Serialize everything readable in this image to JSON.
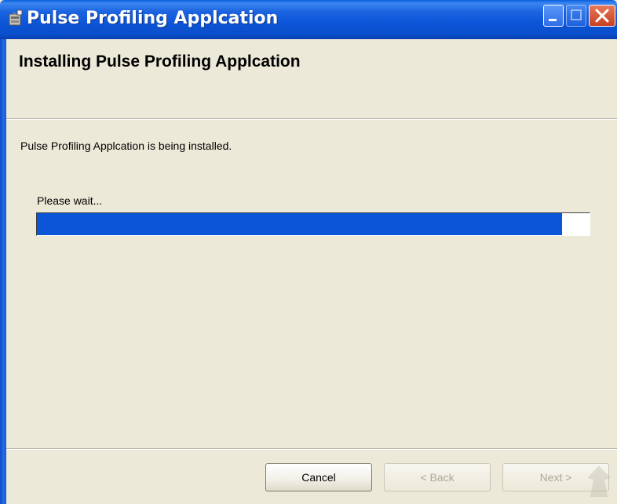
{
  "window": {
    "title": "Pulse Profiling Applcation",
    "icon": "installer-icon"
  },
  "header": {
    "title": "Installing Pulse Profiling Applcation"
  },
  "content": {
    "status": "Pulse Profiling Applcation is being installed.",
    "wait_label": "Please wait...",
    "progress_fraction": 0.95
  },
  "buttons": {
    "cancel": "Cancel",
    "back": "< Back",
    "next": "Next >"
  },
  "colors": {
    "titlebar": "#0a4ec9",
    "progress_fill": "#0b55d8",
    "background": "#ece9d8"
  }
}
